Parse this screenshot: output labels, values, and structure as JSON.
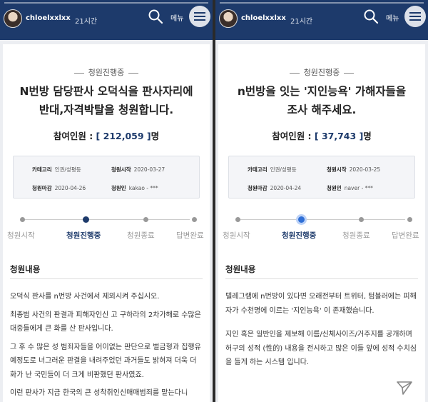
{
  "panels": [
    {
      "username": "chloelxxlxx",
      "time": "21시간",
      "menu_label": "메뉴",
      "status": "청원진행중",
      "title_lines": [
        "N번방 담당판사 오덕식을 판사자리에",
        "반대,자격박탈을 청원합니다."
      ],
      "count_label": "참여인원 : ",
      "count_value": "212,059",
      "count_suffix": "명",
      "info": {
        "category_label": "카테고리",
        "category": "인권/성평등",
        "start_label": "청원시작",
        "start": "2020-03-27",
        "end_label": "청원마감",
        "end": "2020-04-26",
        "author_label": "청원인",
        "author": "kakao - ***"
      },
      "steps": [
        "청원시작",
        "청원진행중",
        "청원종료",
        "답변완료"
      ],
      "active_step": 1,
      "section_title": "청원내용",
      "body": [
        "오덕식 판사를 n번방 사건에서 제외시켜 주십시오.",
        "최종범 사건의 판결과 피해자인신 고 구하라의 2차가해로 수많은 대중들에게 큰 화를 산 판사입니다.",
        "그 후 수 많은 성 범죄자들을 어이없는 판단으로 벌금형과 집행유예정도로 너그러운 판결을 내려주었던 과거들도 밝혀져 더욱 더 화가 난 국민들이 더 크게 비판했던 판사였죠.",
        "이런 판사가 지금 한국의 큰 성착취인신매매범죄를 맡는다니"
      ]
    },
    {
      "username": "chloelxxlxx",
      "time": "21시간",
      "menu_label": "메뉴",
      "status": "청원진행중",
      "title_lines": [
        "n번방을 잇는 '지인능욕' 가해자들을",
        "조사 해주세요."
      ],
      "count_label": "참여인원 : ",
      "count_value": "37,743",
      "count_suffix": "명",
      "info": {
        "category_label": "카테고리",
        "category": "인권/성평등",
        "start_label": "청원시작",
        "start": "2020-03-25",
        "end_label": "청원마감",
        "end": "2020-04-24",
        "author_label": "청원인",
        "author": "naver - ***"
      },
      "steps": [
        "청원시작",
        "청원진행중",
        "청원종료",
        "답변완료"
      ],
      "active_step": 1,
      "section_title": "청원내용",
      "body": [
        "텔레그램에 n번방이 있다면 오래전부터 트위터, 텀블러에는 피해자가 수천명에 이르는 '지인능욕' 이 존재했습니다.",
        "지인 혹은 일반인을 제보해 이름/신체사이즈/거주지를 공개하며 허구의 성적 (性的) 내용을 전시하고 많은 이들 앞에 성적 수치심을 들게 하는 시스템 입니다."
      ]
    }
  ]
}
